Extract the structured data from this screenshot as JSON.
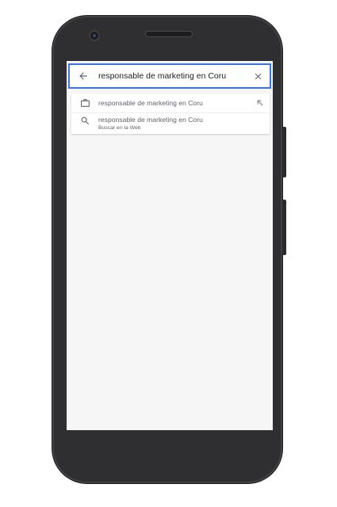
{
  "search": {
    "query": "responsable de marketing en Coru",
    "back_icon": "arrow-back-icon",
    "clear_icon": "close-icon",
    "accent_color": "#3b73e0"
  },
  "suggestions": [
    {
      "icon": "briefcase-icon",
      "primary": "responsable de marketing en Coru",
      "action_icon": "arrow-up-left-icon"
    },
    {
      "icon": "search-icon",
      "primary": "responsable de marketing en Coru",
      "secondary": "Buscar en la Web"
    }
  ]
}
